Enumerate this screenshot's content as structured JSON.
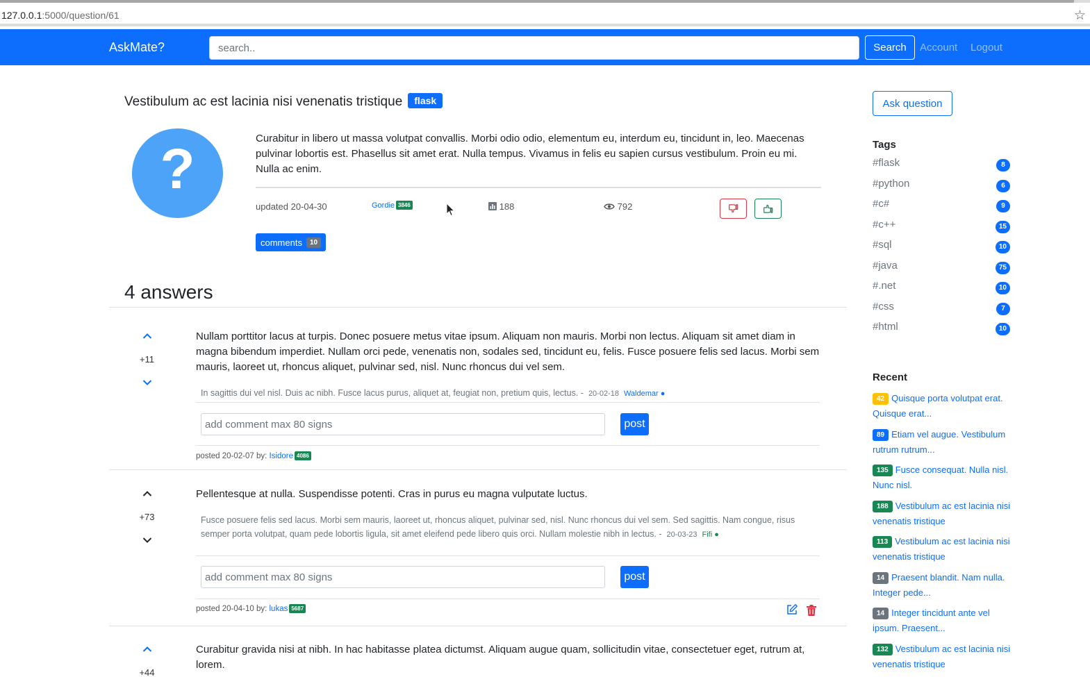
{
  "browser": {
    "url_host": "127.0.0.1",
    "url_path": ":5000/question/61"
  },
  "navbar": {
    "brand": "AskMate?",
    "search_placeholder": "search..",
    "search_label": "Search",
    "account_label": "Account",
    "logout_label": "Logout"
  },
  "question": {
    "title": "Vestibulum ac est lacinia nisi venenatis tristique",
    "tag": "flask",
    "avatar_symbol": "?",
    "body": "Curabitur in libero ut massa volutpat convallis. Morbi odio odio, elementum eu, interdum eu, tincidunt in, leo. Maecenas pulvinar lobortis est. Phasellus sit amet erat. Nulla tempus. Vivamus in felis eu sapien cursus vestibulum. Proin eu mi. Nulla ac enim.",
    "updated": "updated 20-04-30",
    "author": "Gordie",
    "author_rep": "3846",
    "stat_count": "188",
    "views": "792",
    "comments_label": "comments",
    "comments_count": "10"
  },
  "answers": {
    "heading": "4 answers",
    "comment_placeholder": "add comment max 80 signs",
    "post_label": "post",
    "items": [
      {
        "score": "+11",
        "body": "Nullam porttitor lacus at turpis. Donec posuere metus vitae ipsum. Aliquam non mauris. Morbi non lectus. Aliquam sit amet diam in magna bibendum imperdiet. Nullam orci pede, venenatis non, sodales sed, tincidunt eu, felis. Fusce posuere felis sed lacus. Morbi sem mauris, laoreet ut, rhoncus aliquet, pulvinar sed, nisl. Nunc rhoncus dui vel sem.",
        "comment": "In sagittis dui vel nisl. Duis ac nibh. Fusce lacus purus, aliquet at, feugiat non, pretium quis, lectus. -",
        "comment_date": "20-02-18",
        "comment_author": "Waldemar ●",
        "posted": "posted 20-02-07 by:",
        "author": "Isidore",
        "author_rep": "4086"
      },
      {
        "score": "+73",
        "body": "Pellentesque at nulla. Suspendisse potenti. Cras in purus eu magna vulputate luctus.",
        "comment": "Fusce posuere felis sed lacus. Morbi sem mauris, laoreet ut, rhoncus aliquet, pulvinar sed, nisl. Nunc rhoncus dui vel sem. Sed sagittis. Nam congue, risus semper porta volutpat, quam pede lobortis ligula, sit amet eleifend pede libero quis orci. Nullam molestie nibh in lectus. -",
        "comment_date": "20-03-23",
        "comment_author": "Fifi ●",
        "posted": "posted 20-04-10 by:",
        "author": "lukas",
        "author_rep": "5687"
      },
      {
        "score": "+44",
        "body": "Curabitur gravida nisi at nibh. In hac habitasse platea dictumst. Aliquam augue quam, sollicitudin vitae, consectetuer eget, rutrum at, lorem."
      }
    ]
  },
  "sidebar": {
    "ask_label": "Ask question",
    "tags_heading": "Tags",
    "tags": [
      {
        "name": "#flask",
        "count": "8"
      },
      {
        "name": "#python",
        "count": "6"
      },
      {
        "name": "#c#",
        "count": "9"
      },
      {
        "name": "#c++",
        "count": "15"
      },
      {
        "name": "#sql",
        "count": "10"
      },
      {
        "name": "#java",
        "count": "75"
      },
      {
        "name": "#.net",
        "count": "10"
      },
      {
        "name": "#css",
        "count": "7"
      },
      {
        "name": "#html",
        "count": "10"
      }
    ],
    "recent_heading": "Recent",
    "recent": [
      {
        "count": "42",
        "color": "#ffc107",
        "text": "Quisque porta volutpat erat. Quisque erat..."
      },
      {
        "count": "89",
        "color": "#0d6efd",
        "text": "Etiam vel augue. Vestibulum rutrum rutrum..."
      },
      {
        "count": "135",
        "color": "#198754",
        "text": "Fusce consequat. Nulla nisl. Nunc nisl."
      },
      {
        "count": "188",
        "color": "#198754",
        "text": "Vestibulum ac est lacinia nisi venenatis tristique"
      },
      {
        "count": "113",
        "color": "#198754",
        "text": "Vestibulum ac est lacinia nisi venenatis tristique"
      },
      {
        "count": "14",
        "color": "#6c757d",
        "text": "Praesent blandit. Nam nulla. Integer pede..."
      },
      {
        "count": "14",
        "color": "#6c757d",
        "text": "Integer tincidunt ante vel ipsum. Praesent..."
      },
      {
        "count": "132",
        "color": "#198754",
        "text": "Vestibulum ac est lacinia nisi venenatis tristique"
      }
    ]
  },
  "colors": {
    "primary": "#0d6efd",
    "success": "#198754",
    "danger": "#dc3545",
    "warning": "#ffc107",
    "secondary": "#6c757d"
  }
}
